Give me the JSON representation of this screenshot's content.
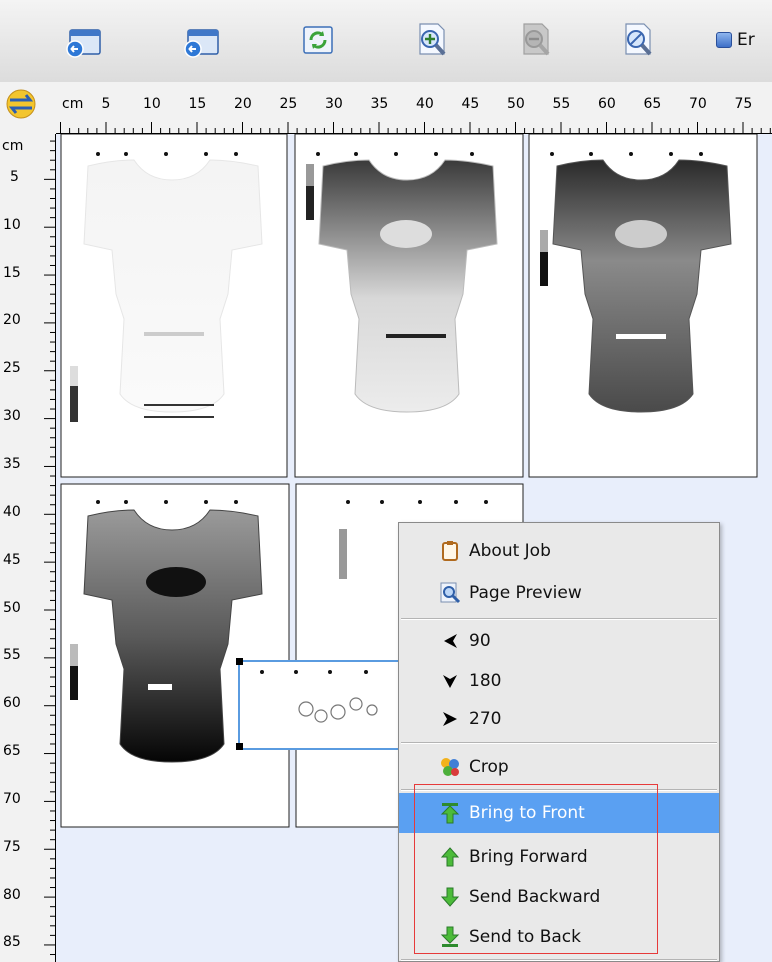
{
  "toolbar": {
    "buttons": [
      {
        "name": "open-job-button",
        "icon": "window-back-icon"
      },
      {
        "name": "open-job-alt-button",
        "icon": "window-back-icon"
      },
      {
        "name": "refresh-button",
        "icon": "refresh-icon"
      },
      {
        "name": "zoom-in-button",
        "icon": "zoom-in-icon"
      },
      {
        "name": "zoom-out-button",
        "icon": "zoom-out-icon"
      },
      {
        "name": "zoom-fit-button",
        "icon": "zoom-fit-icon"
      }
    ],
    "checkbox_label": "Er"
  },
  "ruler": {
    "unit": "cm",
    "h_ticks": [
      "5",
      "10",
      "15",
      "20",
      "25",
      "30",
      "35",
      "40",
      "45",
      "50",
      "55",
      "60",
      "65",
      "70",
      "75"
    ],
    "v_ticks": [
      "5",
      "10",
      "15",
      "20",
      "25",
      "30",
      "35",
      "40",
      "45",
      "50",
      "55",
      "60",
      "65",
      "70",
      "75",
      "80",
      "85"
    ]
  },
  "context_menu": {
    "items": [
      {
        "label": "About Job",
        "icon": "clipboard-icon"
      },
      {
        "label": "Page Preview",
        "icon": "magnifier-icon"
      },
      {
        "label": "90",
        "icon": "arrow-left-icon"
      },
      {
        "label": "180",
        "icon": "arrow-down-icon"
      },
      {
        "label": "270",
        "icon": "arrow-right-icon"
      },
      {
        "label": "Crop",
        "icon": "crop-icon"
      },
      {
        "label": "Bring to Front",
        "icon": "bring-to-front-icon",
        "selected": true
      },
      {
        "label": "Bring Forward",
        "icon": "arrow-up-green-icon"
      },
      {
        "label": "Send Backward",
        "icon": "arrow-down-green-icon"
      },
      {
        "label": "Send to Back",
        "icon": "send-to-back-icon"
      }
    ]
  },
  "colors": {
    "selection": "#5aa0f2",
    "highlight_box": "#e63a3a",
    "canvas": "#e8eefb"
  }
}
